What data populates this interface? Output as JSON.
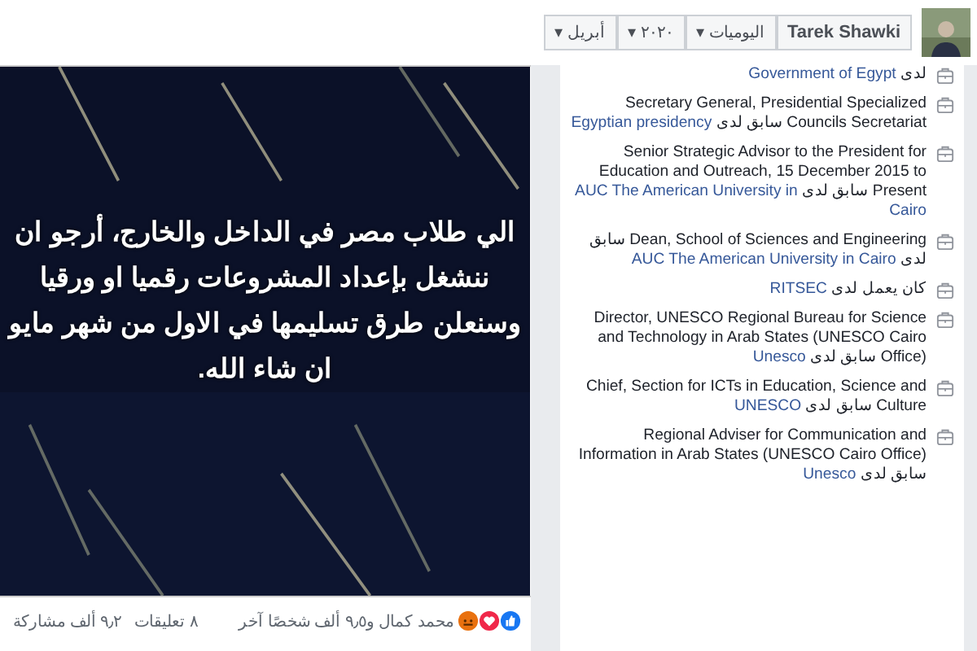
{
  "top_bar": {
    "name_button": "Tarek Shawki",
    "filters": [
      {
        "label": "اليوميات",
        "caret": "▾"
      },
      {
        "label": "٢٠٢٠",
        "caret": "▾"
      },
      {
        "label": "أبريل",
        "caret": "▾"
      }
    ]
  },
  "post": {
    "image": {
      "kind": "picture",
      "caption_lines": [
        "الي طلاب مصر في الداخل والخارج، أرجو ان",
        "ننشغل بإعداد المشروعات رقميا او ورقيا",
        "وسنعلن طرق تسليمها في الاول من شهر مايو",
        "ان شاء الله."
      ]
    },
    "reactions": {
      "summary": "محمد كمال و٩٫٥ ألف شخصًا آخر"
    },
    "comments": "٨ تعليقات",
    "shares": "٩٫٢ ألف مشاركة"
  },
  "work_history": [
    {
      "prefix": "لدى",
      "org": "Government of Egypt"
    },
    {
      "title": "Secretary General, Presidential Specialized Councils Secretariat",
      "prefix": "سابق لدى",
      "org": "Egyptian presidency"
    },
    {
      "title": "Senior Strategic Advisor to the President for Education and Outreach, 15 December 2015 to Present",
      "prefix": "سابق لدى",
      "org": "AUC The American University in Cairo"
    },
    {
      "title": "Dean, School of Sciences and Engineering",
      "prefix": "سابق لدى",
      "org": "AUC The American University in Cairo"
    },
    {
      "prefix": "كان يعمل لدى",
      "org": "RITSEC"
    },
    {
      "title": "Director, UNESCO Regional Bureau for Science and Technology in Arab States (UNESCO Cairo Office)",
      "prefix": "سابق لدى",
      "org": "Unesco"
    },
    {
      "title": "Chief, Section for ICTs in Education, Science and Culture",
      "prefix": "سابق لدى",
      "org": "UNESCO"
    },
    {
      "title": "Regional Adviser for Communication and Information in Arab States (UNESCO Cairo Office)",
      "prefix": "سابق لدى",
      "org": "Unesco"
    }
  ]
}
